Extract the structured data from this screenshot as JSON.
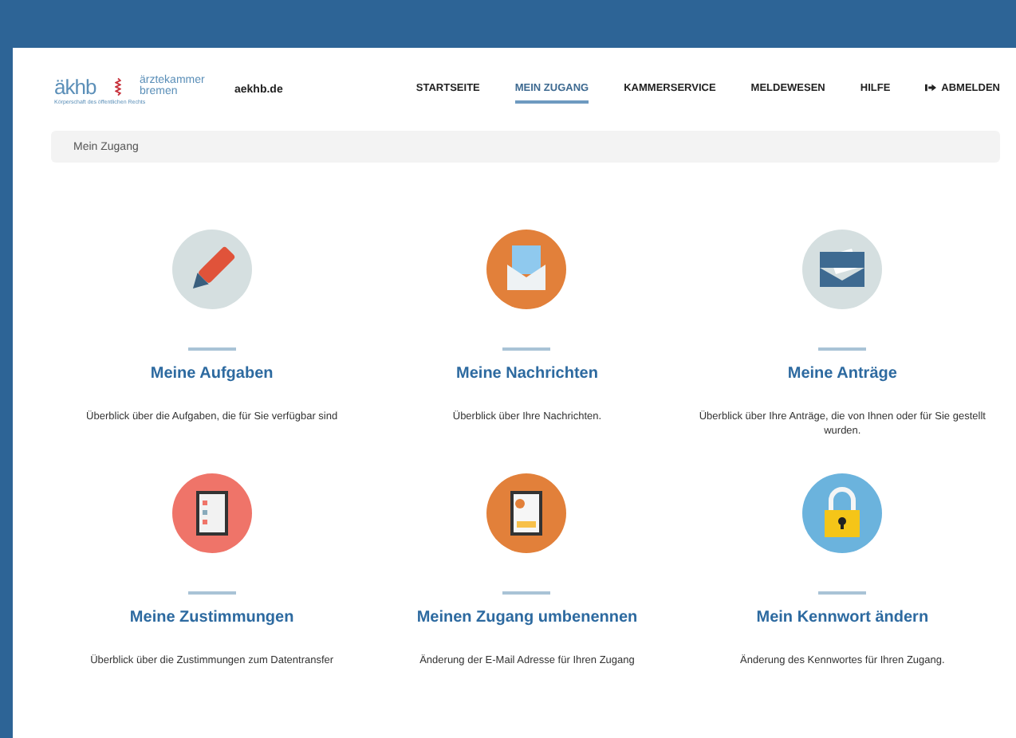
{
  "logo": {
    "mark": "äkhb",
    "name_line1": "ärztekammer",
    "name_line2": "bremen",
    "tagline": "Körperschaft des öffentlichen Rechts"
  },
  "site": "aekhb.de",
  "nav": [
    {
      "label": "STARTSEITE",
      "selected": false
    },
    {
      "label": "MEIN ZUGANG",
      "selected": true
    },
    {
      "label": "KAMMERSERVICE",
      "selected": false
    },
    {
      "label": "MELDEWESEN",
      "selected": false
    },
    {
      "label": "HILFE",
      "selected": false
    },
    {
      "label": "ABMELDEN",
      "selected": false,
      "kind": "logout"
    }
  ],
  "breadcrumb": "Mein Zugang",
  "tiles": [
    {
      "kind": "pencil",
      "color": "#d5dfe0",
      "title": "Meine Aufgaben",
      "description": "Überblick über die Aufgaben, die für Sie verfügbar sind"
    },
    {
      "kind": "mail",
      "color": "#e2803a",
      "title": "Meine Nachrichten",
      "description": "Überblick über Ihre Nachrichten."
    },
    {
      "kind": "tray",
      "color": "#d5dfe0",
      "title": "Meine Anträge",
      "description": "Überblick über Ihre Anträge, die von Ihnen oder für Sie gestellt wurden."
    },
    {
      "kind": "checklist",
      "color": "#ef7469",
      "title": "Meine Zustimmungen",
      "description": "Überblick über die Zustimmungen zum Datentransfer"
    },
    {
      "kind": "clipboard",
      "color": "#e2803a",
      "title": "Meinen Zugang umbenennen",
      "description": "Änderung der E-Mail Adresse für Ihren Zugang"
    },
    {
      "kind": "lock",
      "color": "#6bb3dd",
      "title": "Mein Kennwort ändern",
      "description": "Änderung des Kennwortes für Ihren Zugang."
    }
  ]
}
